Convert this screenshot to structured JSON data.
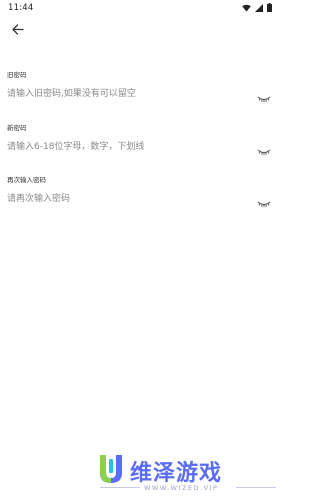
{
  "status_bar": {
    "time": "11:44",
    "icons": [
      "wifi-icon",
      "signal-icon",
      "battery-icon"
    ]
  },
  "header": {
    "back_icon": "arrow-left-icon"
  },
  "form": {
    "fields": [
      {
        "label": "旧密码",
        "value": "",
        "placeholder": "请输入旧密码,如果没有可以留空",
        "toggle_icon": "eye-closed-icon"
      },
      {
        "label": "新密码",
        "value": "",
        "placeholder": "请输入6-18位字母，数字，下划线",
        "toggle_icon": "eye-closed-icon"
      },
      {
        "label": "再次输入密码",
        "value": "",
        "placeholder": "请再次输入密码",
        "toggle_icon": "eye-closed-icon"
      }
    ]
  },
  "watermark": {
    "title": "维泽游戏",
    "subtitle": "WWW.WIZED.VIP"
  },
  "colors": {
    "background": "#ffffff",
    "placeholder": "#8a8a8a",
    "label": "#333333",
    "watermark_blue": "#5b6df4",
    "watermark_green": "#8cd14a",
    "watermark_cyan": "#22c3e6"
  }
}
